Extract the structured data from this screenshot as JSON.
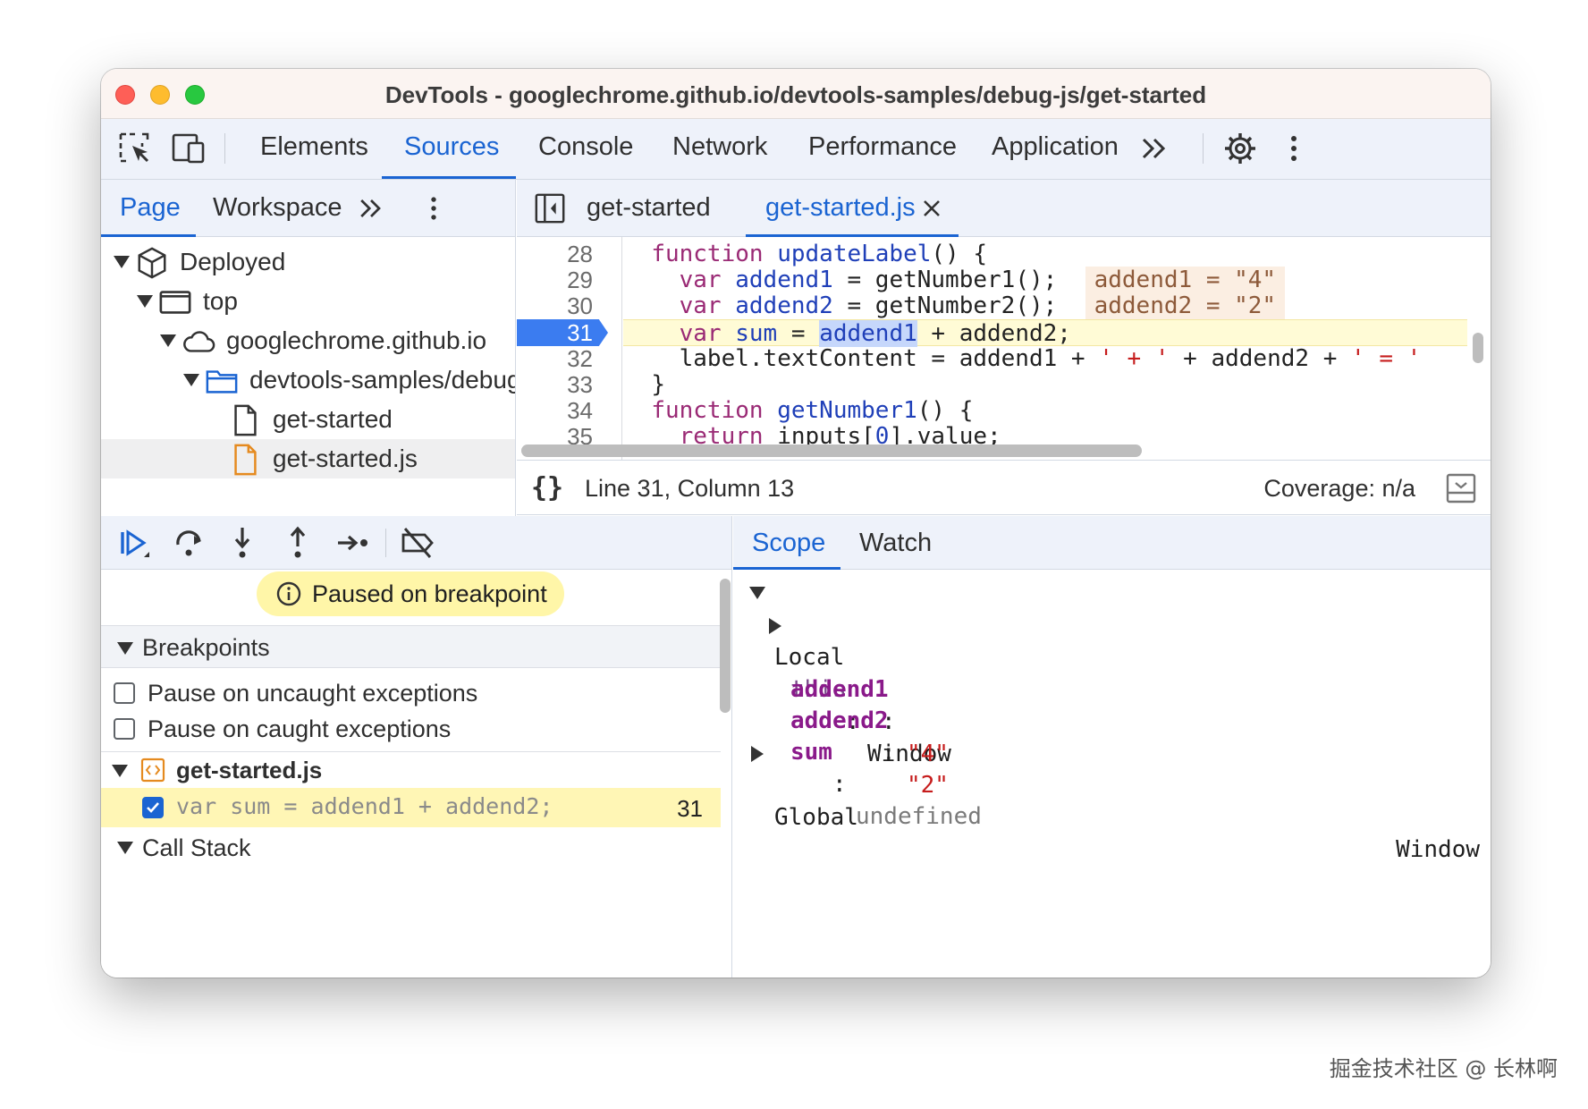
{
  "window": {
    "title": "DevTools - googlechrome.github.io/devtools-samples/debug-js/get-started"
  },
  "toolbar": {
    "icons": [
      "inspect-element-icon",
      "device-toolbar-icon",
      "more-tabs-icon",
      "settings-gear-icon",
      "kebab-menu-icon"
    ],
    "tabs": [
      {
        "label": "Elements"
      },
      {
        "label": "Sources",
        "active": true
      },
      {
        "label": "Console"
      },
      {
        "label": "Network"
      },
      {
        "label": "Performance"
      },
      {
        "label": "Application"
      }
    ],
    "accent_color": "#1a64d2"
  },
  "navigator": {
    "tabs": [
      {
        "label": "Page",
        "active": true
      },
      {
        "label": "Workspace"
      }
    ],
    "tree": [
      {
        "label": "Deployed",
        "icon": "deployed-box-icon"
      },
      {
        "label": "top",
        "icon": "frame-icon"
      },
      {
        "label": "googlechrome.github.io",
        "icon": "cloud-icon"
      },
      {
        "label": "devtools-samples/debug-js",
        "icon": "folder-icon"
      },
      {
        "label": "get-started",
        "icon": "file-icon"
      },
      {
        "label": "get-started.js",
        "icon": "js-file-icon",
        "selected": true
      }
    ]
  },
  "editor": {
    "tabs": [
      {
        "label": "get-started"
      },
      {
        "label": "get-started.js",
        "active": true
      }
    ],
    "lines": [
      {
        "n": "28"
      },
      {
        "n": "29"
      },
      {
        "n": "30"
      },
      {
        "n": "31",
        "active": true
      },
      {
        "n": "32"
      },
      {
        "n": "33"
      },
      {
        "n": "34"
      },
      {
        "n": "35"
      }
    ],
    "code": {
      "l28": {
        "kw": "function",
        "fn": "updateLabel",
        "rest": "() {"
      },
      "l29": {
        "kw": "var",
        "name": "addend1",
        "rest": " = getNumber1();",
        "inline": "addend1 = \"4\""
      },
      "l30": {
        "kw": "var",
        "name": "addend2",
        "rest": " = getNumber2();",
        "inline": "addend2 = \"2\""
      },
      "l31": {
        "kw": "var",
        "name": "sum",
        "eq": " = ",
        "sel": "addend1",
        "rest": " + addend2;"
      },
      "l32": {
        "a": "label.textContent = addend1 + ",
        "s1": "' + '",
        "b": " + addend2 + ",
        "s2": "' = '"
      },
      "l33": {
        "text": "}"
      },
      "l34": {
        "kw": "function",
        "fn": "getNumber1",
        "rest": "() {"
      },
      "l35": {
        "kw": "return",
        "a": " inputs[",
        "num": "0",
        "b": "].value;"
      }
    },
    "status": {
      "position": "Line 31, Column 13",
      "coverage": "Coverage: n/a"
    }
  },
  "debugger": {
    "controls": [
      "resume-icon",
      "step-over-icon",
      "step-into-icon",
      "step-out-icon",
      "step-icon",
      "deactivate-breakpoints-icon"
    ],
    "paused": "Paused on breakpoint",
    "breakpoints_header": "Breakpoints",
    "options": [
      {
        "label": "Pause on uncaught exceptions",
        "checked": false
      },
      {
        "label": "Pause on caught exceptions",
        "checked": false
      }
    ],
    "file": "get-started.js",
    "breakpoint": {
      "code": "var sum = addend1 + addend2;",
      "line": "31",
      "checked": true
    },
    "call_stack_header": "Call Stack"
  },
  "scope": {
    "tabs": [
      {
        "label": "Scope",
        "active": true
      },
      {
        "label": "Watch"
      }
    ],
    "local_label": "Local",
    "this": {
      "name": "this",
      "value": "Window"
    },
    "vars": [
      {
        "name": "addend1",
        "value": "\"4\""
      },
      {
        "name": "addend2",
        "value": "\"2\""
      },
      {
        "name": "sum",
        "value": "undefined"
      }
    ],
    "global": {
      "label": "Global",
      "value": "Window"
    }
  },
  "watermark": "掘金技术社区 @ 长林啊"
}
